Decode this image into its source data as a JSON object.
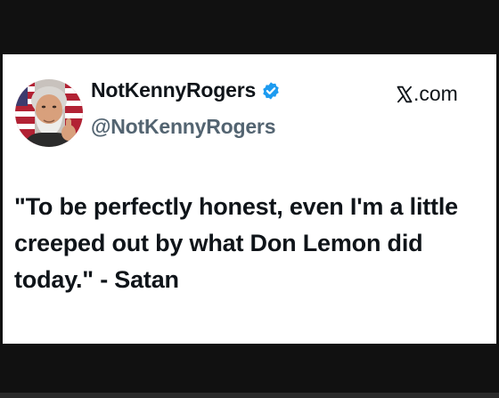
{
  "tweet_card": {
    "author": {
      "display_name": "NotKennyRogers",
      "handle": "@NotKennyRogers",
      "verified": true,
      "avatar": "avatar-photo"
    },
    "site": {
      "logo_icon": "x-logo-icon",
      "domain_suffix": ".com"
    },
    "text": "\"To be perfectly honest, even I'm a little creeped out by what Don Lemon did today.\" - Satan"
  },
  "colors": {
    "background": "#111111",
    "card": "#ffffff",
    "text": "#0f1419",
    "handle": "#536471",
    "verified_badge": "#1d9bf0"
  }
}
